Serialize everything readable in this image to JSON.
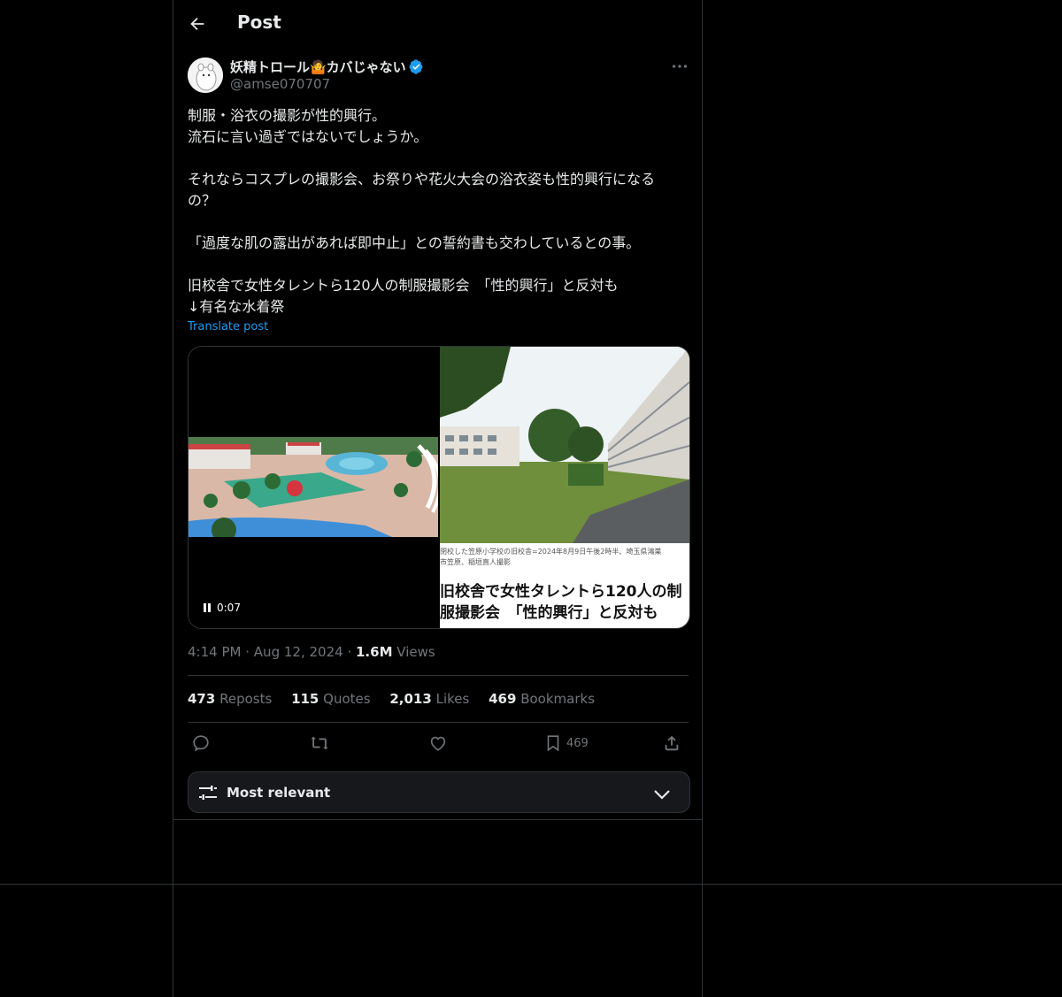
{
  "header": {
    "title": "Post"
  },
  "author": {
    "name": "妖精トロール🤷カバじゃない",
    "handle": "@amse070707"
  },
  "post": {
    "lines": [
      "制服・浴衣の撮影が性的興行。",
      "流石に言い過ぎではないでしょうか。",
      "",
      "それならコスプレの撮影会、お祭りや花火大会の浴衣姿も性的興行になる",
      "の？",
      "",
      "「過度な肌の露出があれば即中止」との誓約書も交わしているとの事。",
      "",
      "旧校舎で女性タレントら120人の制服撮影会　「性的興行」と反対も",
      "↓有名な水着祭"
    ],
    "translate_label": "Translate post"
  },
  "media": {
    "video_time": "0:07",
    "photo_caption_1": "閉校した笠原小学校の旧校舎=2024年8月9日午後2時半、埼玉県鴻巣",
    "photo_caption_2": "市笠原、稲垣直人撮影",
    "photo_headline_1": "旧校舎で女性タレントら120人の制",
    "photo_headline_2": "服撮影会　「性的興行」と反対も"
  },
  "meta": {
    "time": "4:14 PM",
    "sep1": "·",
    "date": "Aug 12, 2024",
    "sep2": "·",
    "views_count": "1.6M",
    "views_label": "Views"
  },
  "stats": {
    "reposts_count": "473",
    "reposts_label": "Reposts",
    "quotes_count": "115",
    "quotes_label": "Quotes",
    "likes_count": "2,013",
    "likes_label": "Likes",
    "bookmarks_count": "469",
    "bookmarks_label": "Bookmarks"
  },
  "actions": {
    "bookmark_count": "469",
    "icons": [
      "reply-icon",
      "repost-icon",
      "like-icon",
      "bookmark-icon",
      "share-icon"
    ]
  },
  "sort": {
    "label": "Most relevant"
  },
  "colors": {
    "background": "#000000",
    "text": "#e7e9ea",
    "muted": "#71767b",
    "accent": "#1d9bf0",
    "border": "#2f3336"
  }
}
